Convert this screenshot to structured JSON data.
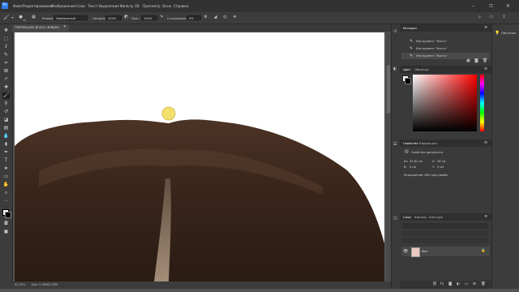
{
  "menu": [
    "Файл",
    "Редактирование",
    "Изображение",
    "Слои",
    "Текст",
    "Выделение",
    "Фильтр",
    "3D",
    "Просмотр",
    "Окно",
    "Справка"
  ],
  "options": {
    "mode_label": "Режим:",
    "mode_value": "Нормальный",
    "opacity_label": "Непрозр.:",
    "opacity_value": "100%",
    "flow_label": "Наж.:",
    "flow_value": "100%",
    "smoothing_label": "Сглаживание:",
    "smoothing_value": "0%",
    "brush_size": "15"
  },
  "document": {
    "tab_title": "ПОРТЕКА.JPG @ 62% (RGB/8*)",
    "status_zoom": "62,32%",
    "status_doc": "Док: 5,39M/5,39M"
  },
  "history": {
    "tabs": [
      "История"
    ],
    "items": [
      "Инструмент \"Кисть\"",
      "Инструмент \"Кисть\"",
      "Инструмент \"Кисть\""
    ]
  },
  "color": {
    "tabs": [
      "Цвет",
      "Образцы"
    ]
  },
  "properties": {
    "tabs": [
      "Свойства",
      "Коррекция"
    ],
    "doc_props_label": "Свойства документа",
    "w_label": "Ш:",
    "w_value": "35,81 см",
    "h_label": "В:",
    "h_value": "0 см",
    "x_label": "X:",
    "x_value": "56 см",
    "y_label": "Y:",
    "y_value": "0 см",
    "resolution": "Разрешение: 600 пикс/дюйм"
  },
  "layers": {
    "tabs": [
      "Слои",
      "Каналы",
      "Контуры"
    ],
    "layer_name": "Фон"
  },
  "learn_label": "Обучение",
  "colors": {
    "menubar": "#323232",
    "panel": "#3a3a3a",
    "canvas": "#ffffff",
    "brush_cursor": "#f2e06b"
  }
}
